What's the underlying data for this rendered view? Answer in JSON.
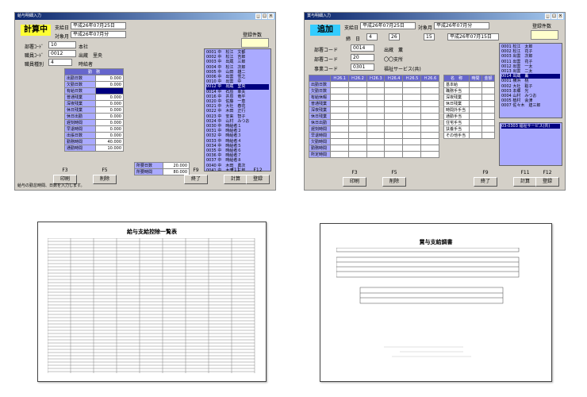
{
  "left_window": {
    "title": "給与明細入力",
    "mode": "計算中",
    "pay_date_label": "支給日",
    "pay_date": "平成26年07月25日",
    "target_month_label": "対象月",
    "target_month": "平成26年07月分",
    "registered_label": "登録件数",
    "dept_code_label": "部署ｺｰﾄﾞ",
    "dept_code": "10",
    "dept_name": "本社",
    "emp_code_label": "職員ｺｰﾄﾞ",
    "emp_code": "0012",
    "emp_name": "出蔵　里央",
    "emp_type_label": "職員種別",
    "emp_type": "4",
    "emp_type_name": "時給者",
    "table_header": "勤　務",
    "rows": [
      {
        "label": "出勤日数",
        "value": "0.000"
      },
      {
        "label": "欠勤日数",
        "value": "0.000"
      },
      {
        "label": "有給日数",
        "value": ""
      },
      {
        "label": "普通残業",
        "value": "0.000"
      },
      {
        "label": "深夜残業",
        "value": "0.000"
      },
      {
        "label": "休日残業",
        "value": "0.000"
      },
      {
        "label": "休日出勤",
        "value": "0.000"
      },
      {
        "label": "遅刻時間",
        "value": "0.000"
      },
      {
        "label": "早退時間",
        "value": "0.000"
      },
      {
        "label": "出張日数",
        "value": "0.000"
      },
      {
        "label": "勤務時間",
        "value": "40.000"
      },
      {
        "label": "通勤時間",
        "value": "10.000"
      }
    ],
    "extra_rows": [
      {
        "label": "所要日数",
        "value": "20.000"
      },
      {
        "label": "所要時間",
        "value": "80.000"
      }
    ],
    "list": [
      "0001 中　松江　文都",
      "0002 中　松江　吉郎",
      "0003 中　出蔵　三郎",
      "0004 中　松江　次郎",
      "0005 中　山田　雄二",
      "0006 中　出雲　雪之",
      "0010 中　出雲　中　",
      "0012 中　出蔵　里央",
      "0014 中　石原　幸夫",
      "0016 中　井原　竜平",
      "0020 中　佐藤　一恵",
      "0021 中　大社　春花",
      "0022 中　木田　正行",
      "0023 中　安来　智子",
      "0024 中　山村　みつお",
      "0030 中　時給者１",
      "0031 中　時給者２",
      "0032 中　時給者３",
      "0033 中　時給者４",
      "0034 中　時給者５",
      "0035 中　時給者６",
      "0036 中　時給者７",
      "0037 中　時給者８",
      "0040 中　木田　勇次",
      "0041 中　木田　三郎"
    ],
    "selected_index": 7,
    "fkeys": [
      {
        "key": "F3",
        "label": "印刷"
      },
      {
        "key": "F5",
        "label": "削除"
      },
      {
        "key": "F9",
        "label": "終了"
      },
      {
        "key": "F11",
        "label": "計算"
      },
      {
        "key": "F12",
        "label": "登録"
      }
    ],
    "status": "給与の勤怠時間、日数を入力します。"
  },
  "right_window": {
    "title": "賞与明細入力",
    "mode": "追加",
    "pay_date_label": "支給日",
    "pay_date": "平成26年07月25日",
    "target_month_label": "対象月",
    "target_month": "平成26年07月分",
    "registered_label": "登録件数",
    "period_label": "締　日",
    "period_from_month": "4",
    "period_from_year": "26",
    "period_from_day": "15",
    "period_from": "平成26年07月15日",
    "dept_code_label": "部署コード",
    "dept_code": "0014",
    "dept_name": "出蔵　薫",
    "staff_code_label": "部署コード",
    "staff_code": "20",
    "staff_name": "〇〇支所",
    "office_code_label": "事業コード",
    "office_code": "0301",
    "office_name": "福祉サービス(共)",
    "grid_header": [
      "",
      "Ｈ26.1",
      "Ｈ26.2",
      "Ｈ26.3",
      "Ｈ26.4",
      "Ｈ26.5",
      "Ｈ26.6"
    ],
    "grid_rows": [
      "出勤日数",
      "欠勤日数",
      "有給休暇",
      "普通残業",
      "深夜残業",
      "休日残業",
      "休日出勤",
      "遅刻時間",
      "早退時間",
      "欠勤時間",
      "勤務時間",
      "所定時間"
    ],
    "side_header": [
      "名　称",
      "時間",
      "金額"
    ],
    "side_rows": [
      "基本給",
      "職務手当",
      "深夜残業",
      "休日残業",
      "時間外手当",
      "通勤手当",
      "住宅手当",
      "扶養手当",
      "その他手当"
    ],
    "list": [
      "0001 松江　太郎",
      "0002 松江　花子",
      "0003 出雲　次郎",
      "0011 出雲　花子",
      "0012 出雲　一太",
      "0013 出雲　二太",
      "0014 出蔵　薫",
      "0001 横浜　桃",
      "0002 大社　聡子",
      "0003 本郷　光",
      "0004 山村　みつお",
      "0005 植村　会津",
      "0007 佐々木　建三郎"
    ],
    "selected_index": 6,
    "sub_list": "03-0303 福祉サービス(共)",
    "fkeys": [
      {
        "key": "F3",
        "label": "印刷"
      },
      {
        "key": "F5",
        "label": "削除"
      },
      {
        "key": "F9",
        "label": "終了"
      },
      {
        "key": "F11",
        "label": "計算"
      },
      {
        "key": "F12",
        "label": "登録"
      }
    ]
  },
  "doc_left": {
    "title": "給与支給控除一覧表"
  },
  "doc_right": {
    "title": "賞与支給調書"
  }
}
